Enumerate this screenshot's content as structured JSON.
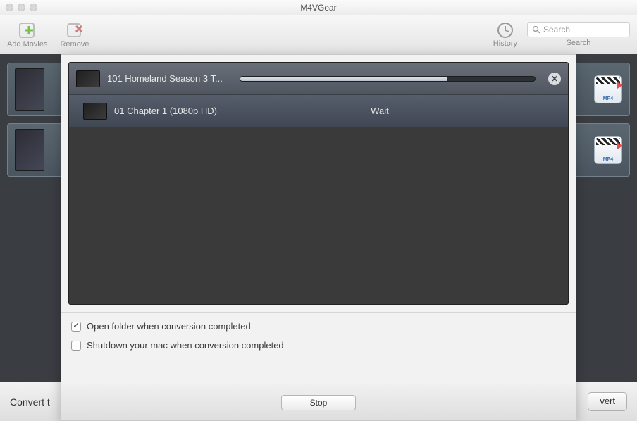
{
  "window": {
    "title": "M4VGear"
  },
  "toolbar": {
    "add_label": "Add Movies",
    "remove_label": "Remove",
    "history_label": "History",
    "search_placeholder": "Search",
    "search_label": "Search"
  },
  "queue": {
    "items": [
      {
        "poster": "homeland",
        "format": "MP4"
      },
      {
        "poster": "house-of-cards",
        "format": "MP4"
      }
    ]
  },
  "footer": {
    "convert_to_label": "Convert t",
    "convert_button_visible": "vert"
  },
  "modal": {
    "rows": [
      {
        "title": "101 Homeland Season 3 T...",
        "progress_pct": 70
      },
      {
        "title": "01 Chapter 1 (1080p HD)",
        "status": "Wait"
      }
    ],
    "options": {
      "open_folder": {
        "label": "Open folder when conversion completed",
        "checked": true
      },
      "shutdown": {
        "label": "Shutdown your mac when conversion completed",
        "checked": false
      }
    },
    "stop_label": "Stop"
  }
}
